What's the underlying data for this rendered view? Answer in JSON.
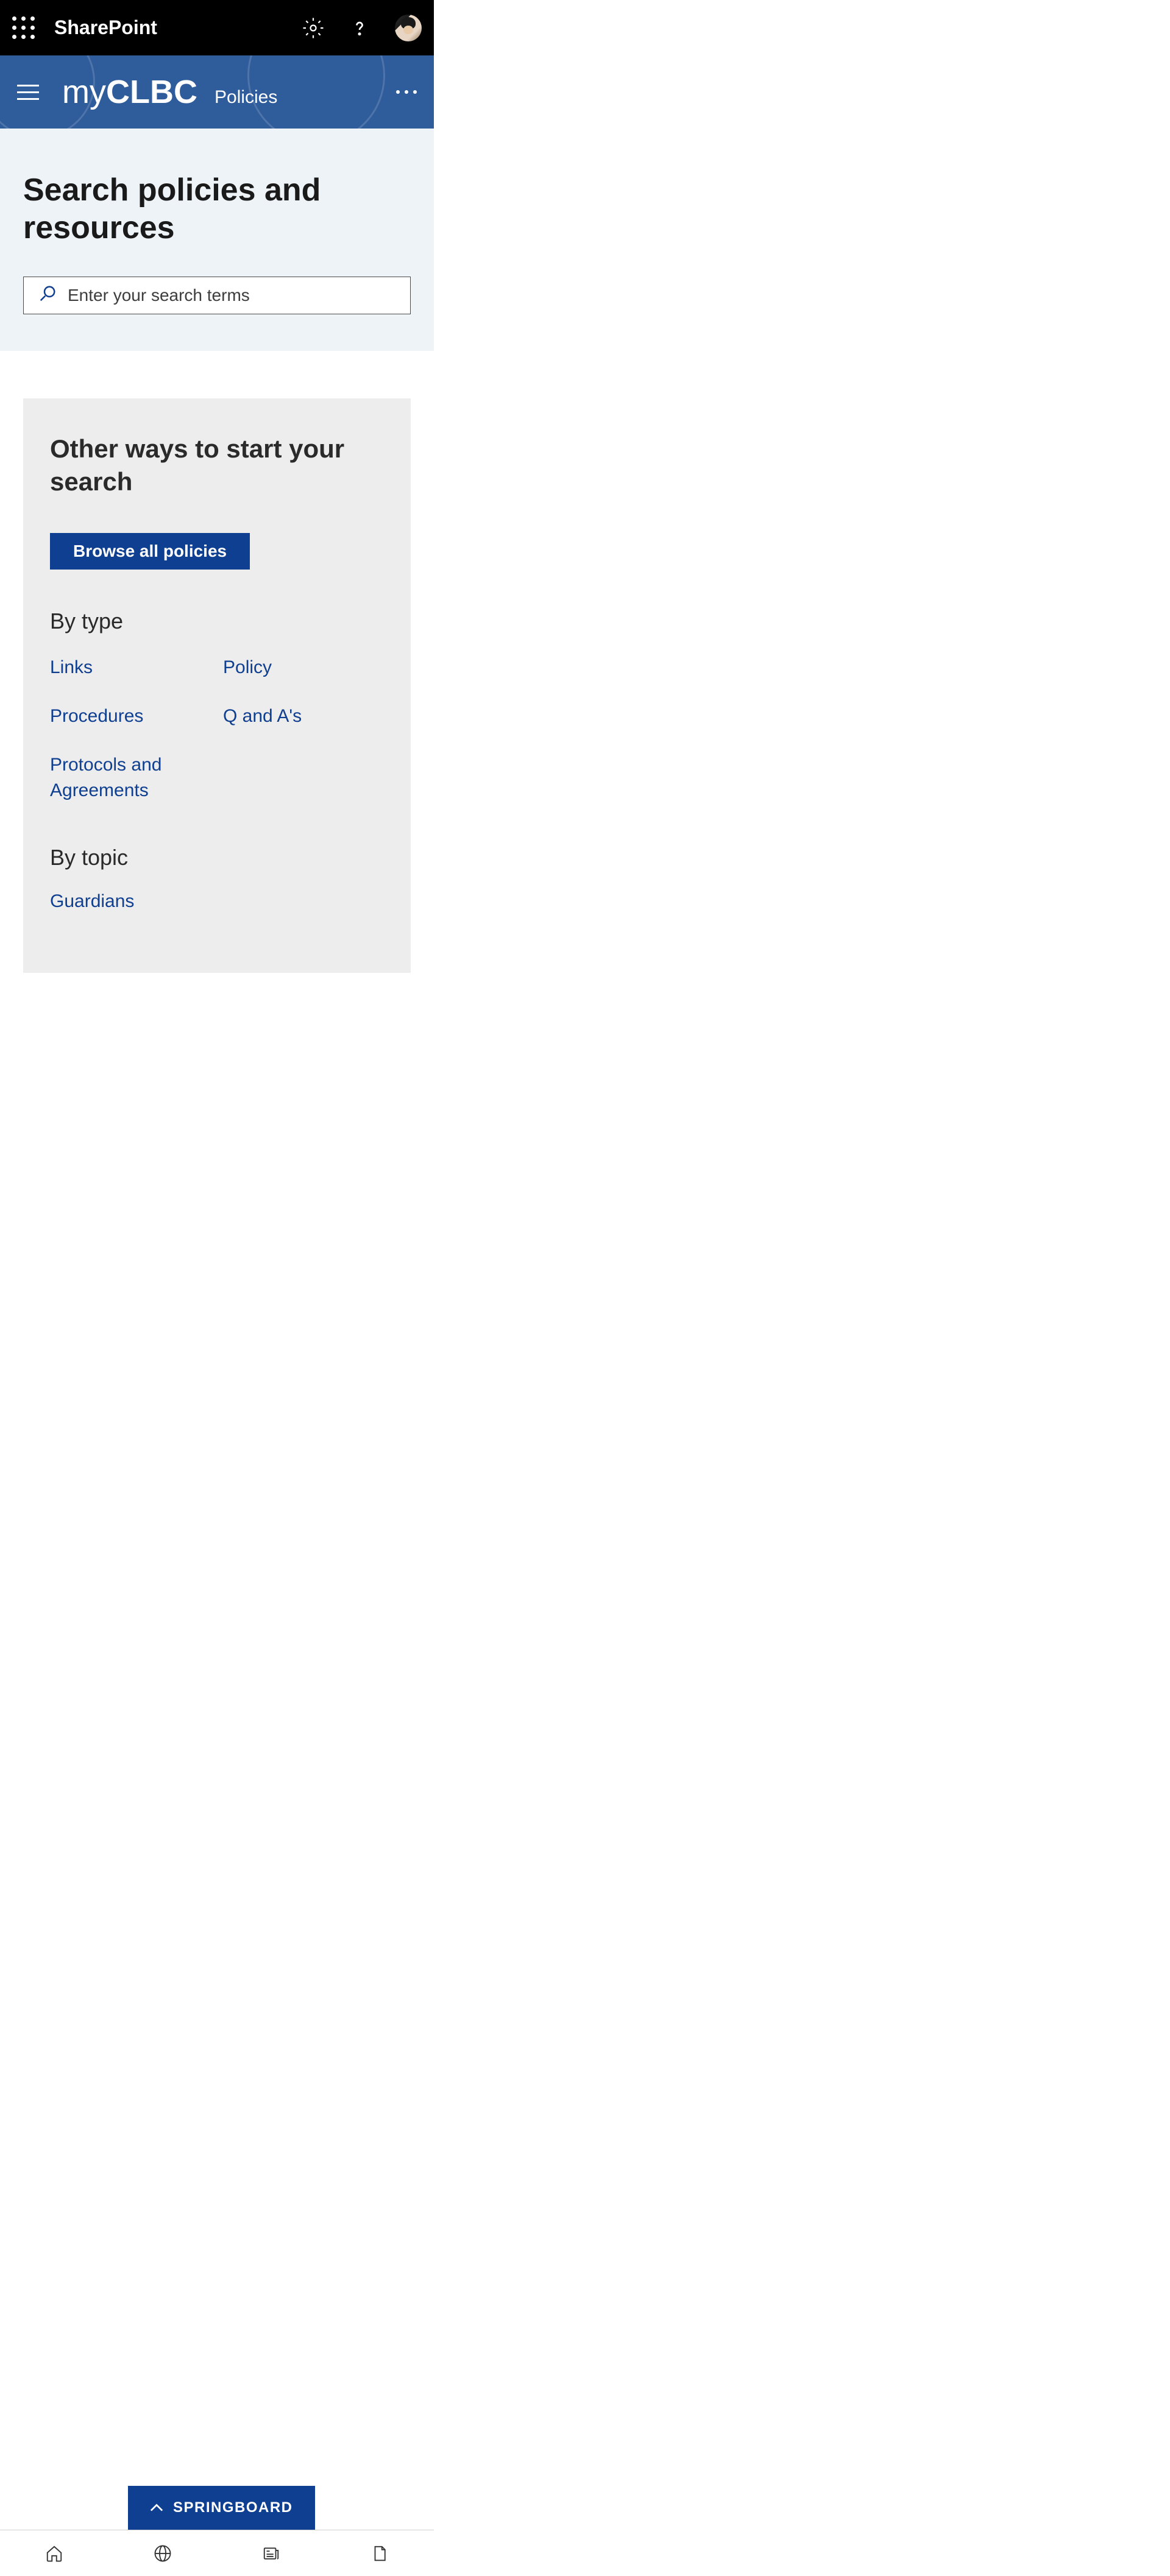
{
  "topBar": {
    "appName": "SharePoint"
  },
  "siteHeader": {
    "logoPrefix": "my",
    "logoBold": "CLBC",
    "section": "Policies"
  },
  "searchSection": {
    "title": "Search policies and resources",
    "placeholder": "Enter your search terms"
  },
  "otherWays": {
    "title": "Other ways to start your search",
    "browseButton": "Browse all policies",
    "byType": {
      "heading": "By type",
      "links": [
        "Links",
        "Policy",
        "Procedures",
        "Q and A's",
        "Protocols and Agreements"
      ]
    },
    "byTopic": {
      "heading": "By topic",
      "links": [
        "Guardians"
      ]
    }
  },
  "springboard": {
    "label": "SPRINGBOARD"
  }
}
